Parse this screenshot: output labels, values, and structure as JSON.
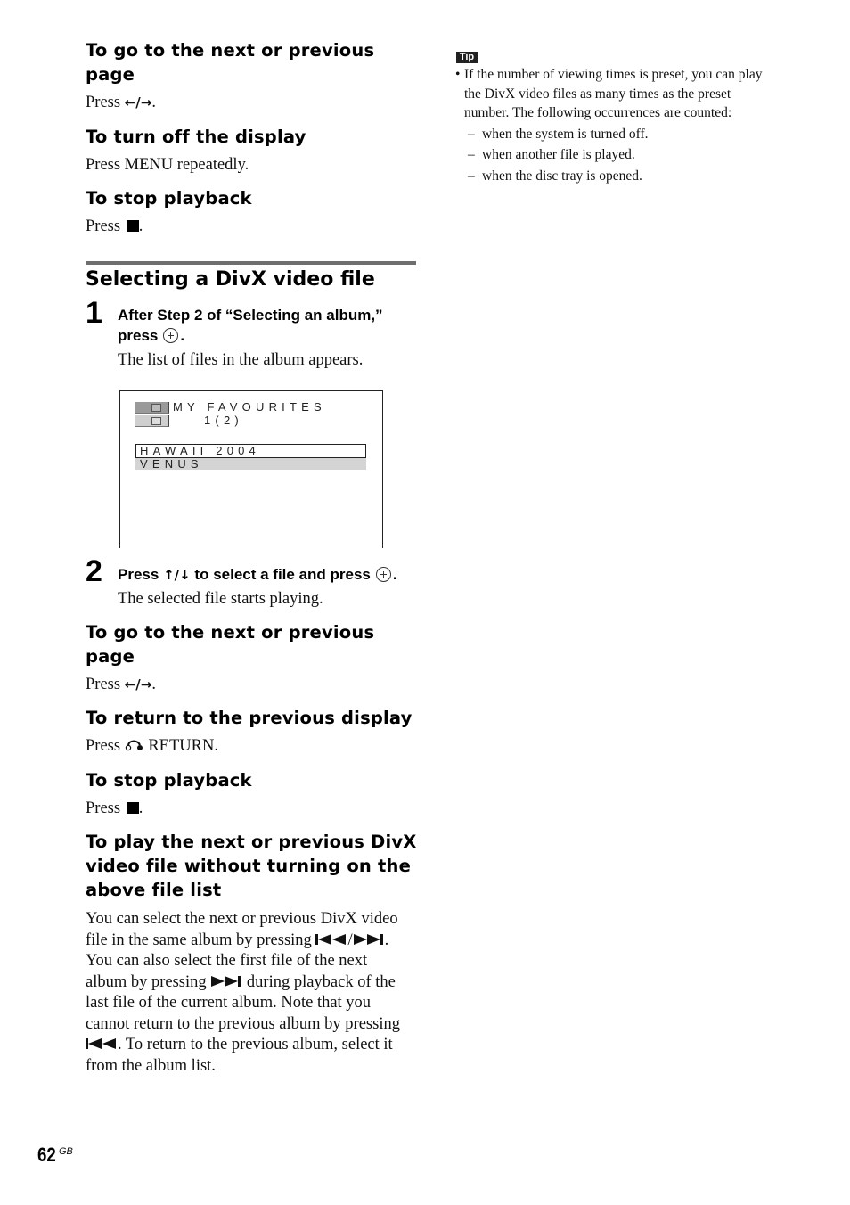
{
  "top_section": {
    "next_prev_page": {
      "heading_line1": "To go to the next or previous",
      "heading_line2": "page",
      "press": "Press",
      "keys": "←/→",
      "end": "."
    },
    "turn_off_display": {
      "heading": "To turn off the display",
      "text": "Press MENU repeatedly."
    },
    "stop_playback": {
      "heading": "To stop playback",
      "press": "Press",
      "end": "."
    }
  },
  "section": {
    "title": "Selecting a DivX video file",
    "steps": [
      {
        "number": "1",
        "line1": "After Step 2 of “Selecting an album,”",
        "line2": "press",
        "line2_end": ".",
        "result": "The list of files in the album appears."
      },
      {
        "number": "2",
        "text_before": "Press",
        "keys": "↑/↓",
        "text_after": "to select a file and press",
        "end": ".",
        "result": "The selected file starts playing."
      }
    ]
  },
  "osd_screen": {
    "album_title": "MY FAVOURITES",
    "page_indicator": "1(2)",
    "files": [
      {
        "name": "HAWAII 2004",
        "state": "selected"
      },
      {
        "name": "VENUS",
        "state": "highlighted"
      }
    ]
  },
  "bottom_section": {
    "next_prev_page": {
      "heading_line1": "To go to the next or previous",
      "heading_line2": "page",
      "press": "Press",
      "keys": "←/→",
      "end": "."
    },
    "return_display": {
      "heading": "To return to the previous display",
      "press": "Press",
      "button": "RETURN."
    },
    "stop_playback": {
      "heading": "To stop playback",
      "press": "Press",
      "end": "."
    },
    "play_next_prev": {
      "heading_lines": [
        "To play the next or previous DivX",
        "video file without turning on the",
        "above file list"
      ],
      "para": {
        "l1": "You can select the next or previous DivX video",
        "l2a": "file in the same album by pressing",
        "l2b": "/",
        "l2c": ".",
        "l3": "You can also select the first file of the next",
        "l4a": "album by pressing",
        "l4b": "during playback of the",
        "l5": "last file of the current album. Note that you",
        "l6": "cannot return to the previous album by pressing",
        "l7": ". To return to the previous album, select it",
        "l8": "from the album list."
      }
    }
  },
  "tip": {
    "badge": "Tip",
    "bullet": "•",
    "lines": [
      "If the number of viewing times is preset, you can play",
      "the DivX video files as many times as the preset",
      "number. The following occurrences are counted:"
    ],
    "dash": "–",
    "items": [
      "when the system is turned off.",
      "when another file is played.",
      "when the disc tray is opened."
    ]
  },
  "footer": {
    "page_number": "62",
    "suffix": "GB"
  }
}
